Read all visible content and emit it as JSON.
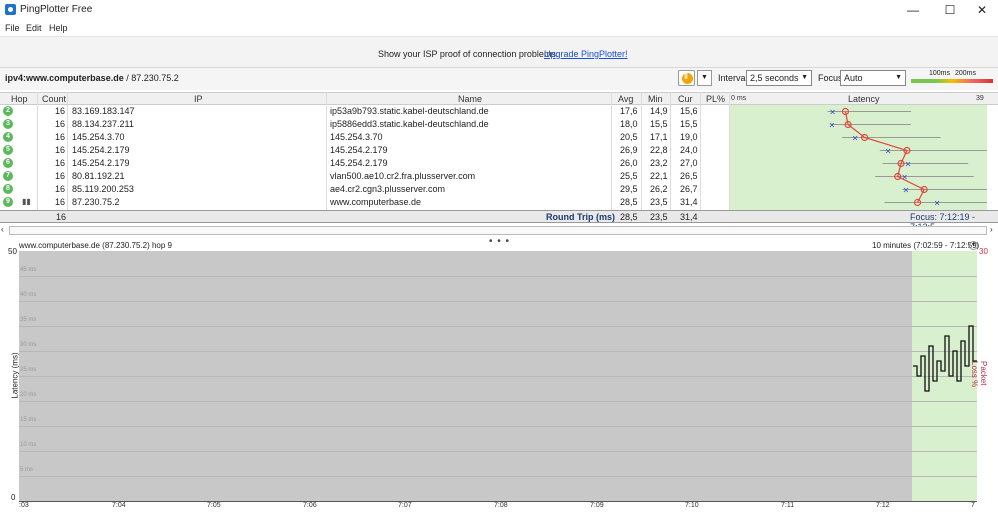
{
  "window": {
    "title": "PingPlotter Free",
    "minimize": "—",
    "maximize": "☐",
    "close": "✕"
  },
  "menu": [
    "File",
    "Edit",
    "Help"
  ],
  "promo": {
    "text": "Show your ISP proof of connection problems.",
    "link": "Upgrade PingPlotter!"
  },
  "toolbar": {
    "target_host": "ipv4:www.computerbase.de",
    "target_ip": " / 87.230.75.2",
    "interval_label": "Interval",
    "interval_value": "2,5 seconds",
    "focus_label": "Focus",
    "focus_value": "Auto",
    "scale_100": "100ms",
    "scale_200": "200ms"
  },
  "table": {
    "headers": {
      "hop": "Hop",
      "count": "Count",
      "ip": "IP",
      "name": "Name",
      "avg": "Avg",
      "min": "Min",
      "cur": "Cur",
      "pl": "PL%",
      "zero": "0 ms",
      "latency": "Latency",
      "max": "39"
    },
    "rows": [
      {
        "hop": "2",
        "count": "16",
        "ip": "83.169.183.147",
        "name": "ip53a9b793.static.kabel-deutschland.de",
        "avg": "17,6",
        "min": "14,9",
        "cur": "15,6"
      },
      {
        "hop": "3",
        "count": "16",
        "ip": "88.134.237.211",
        "name": "ip5886edd3.static.kabel-deutschland.de",
        "avg": "18,0",
        "min": "15,5",
        "cur": "15,5"
      },
      {
        "hop": "4",
        "count": "16",
        "ip": "145.254.3.70",
        "name": "145.254.3.70",
        "avg": "20,5",
        "min": "17,1",
        "cur": "19,0"
      },
      {
        "hop": "5",
        "count": "16",
        "ip": "145.254.2.179",
        "name": "145.254.2.179",
        "avg": "26,9",
        "min": "22,8",
        "cur": "24,0"
      },
      {
        "hop": "6",
        "count": "16",
        "ip": "145.254.2.179",
        "name": "145.254.2.179",
        "avg": "26,0",
        "min": "23,2",
        "cur": "27,0"
      },
      {
        "hop": "7",
        "count": "16",
        "ip": "80.81.192.21",
        "name": "vlan500.ae10.cr2.fra.plusserver.com",
        "avg": "25,5",
        "min": "22,1",
        "cur": "26,5"
      },
      {
        "hop": "8",
        "count": "16",
        "ip": "85.119.200.253",
        "name": "ae4.cr2.cgn3.plusserver.com",
        "avg": "29,5",
        "min": "26,2",
        "cur": "26,7"
      },
      {
        "hop": "9",
        "count": "16",
        "ip": "87.230.75.2",
        "name": "www.computerbase.de",
        "avg": "28,5",
        "min": "23,5",
        "cur": "31,4"
      }
    ],
    "summary": {
      "count": "16",
      "label": "Round Trip (ms)",
      "avg": "28,5",
      "min": "23,5",
      "cur": "31,4",
      "focus": "Focus: 7:12:19 - 7:12:5"
    }
  },
  "graph": {
    "title": "www.computerbase.de (87.230.75.2) hop 9",
    "range": "10 minutes (7:02:59 - 7:12:59)",
    "y_max": "50",
    "y_min": "0",
    "y_ticks": [
      "45 ms",
      "40 ms",
      "35 ms",
      "30 ms",
      "25 ms",
      "20 ms",
      "15 ms",
      "10 ms",
      "5 ms"
    ],
    "pl_max": "30",
    "y_title": "Latency (ms)",
    "pl_title": "Packet Loss %",
    "x_ticks": [
      ":03",
      "7:04",
      "7:05",
      "7:06",
      "7:07",
      "7:08",
      "7:09",
      "7:10",
      "7:11",
      "7:12",
      "7"
    ],
    "splitter": "• • •"
  },
  "colors": {
    "green_panel": "#d9f0cf",
    "hop_badge": "#5cb85c",
    "trace_line": "#e0463a",
    "link": "#1a4fd6"
  }
}
